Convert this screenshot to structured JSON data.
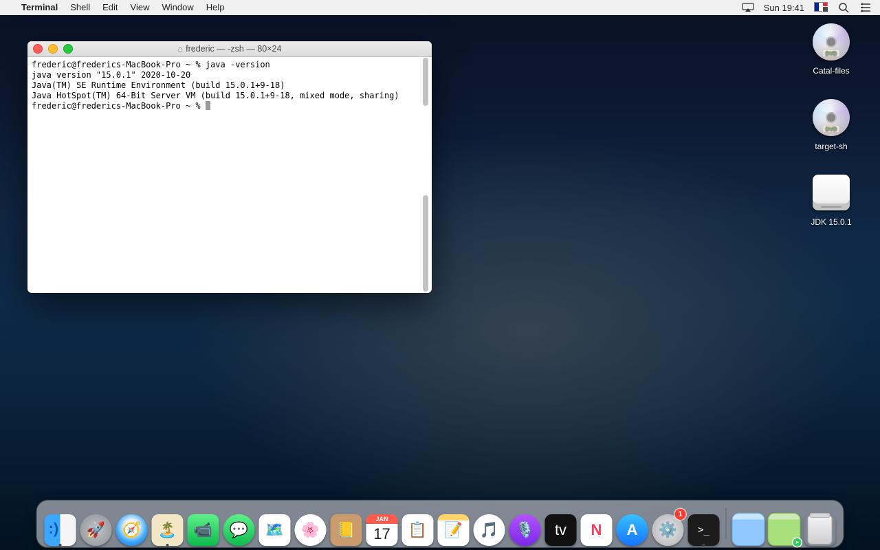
{
  "menubar": {
    "apple": "",
    "app": "Terminal",
    "items": [
      "Shell",
      "Edit",
      "View",
      "Window",
      "Help"
    ],
    "clock": "Sun 19:41"
  },
  "desktop_icons": [
    {
      "type": "disc",
      "label": "Catal-files"
    },
    {
      "type": "disc",
      "label": "target-sh"
    },
    {
      "type": "drive",
      "label": "JDK 15.0.1"
    }
  ],
  "terminal": {
    "title": "frederic — -zsh — 80×24",
    "lines": [
      "frederic@frederics-MacBook-Pro ~ % java -version",
      "java version \"15.0.1\" 2020-10-20",
      "Java(TM) SE Runtime Environment (build 15.0.1+9-18)",
      "Java HotSpot(TM) 64-Bit Server VM (build 15.0.1+9-18, mixed mode, sharing)"
    ],
    "prompt": "frederic@frederics-MacBook-Pro ~ % "
  },
  "dock": {
    "calendar": {
      "month": "JAN",
      "day": "17"
    },
    "settings_badge": "1",
    "apps": [
      {
        "name": "finder",
        "running": true
      },
      {
        "name": "launchpad"
      },
      {
        "name": "safari"
      },
      {
        "name": "preview",
        "running": true
      },
      {
        "name": "facetime"
      },
      {
        "name": "messages"
      },
      {
        "name": "maps"
      },
      {
        "name": "photos"
      },
      {
        "name": "contacts"
      },
      {
        "name": "calendar"
      },
      {
        "name": "reminders"
      },
      {
        "name": "notes"
      },
      {
        "name": "music"
      },
      {
        "name": "podcasts"
      },
      {
        "name": "appletv"
      },
      {
        "name": "news"
      },
      {
        "name": "appstore"
      },
      {
        "name": "system-preferences",
        "badge": "1"
      },
      {
        "name": "terminal",
        "running": true
      }
    ]
  }
}
